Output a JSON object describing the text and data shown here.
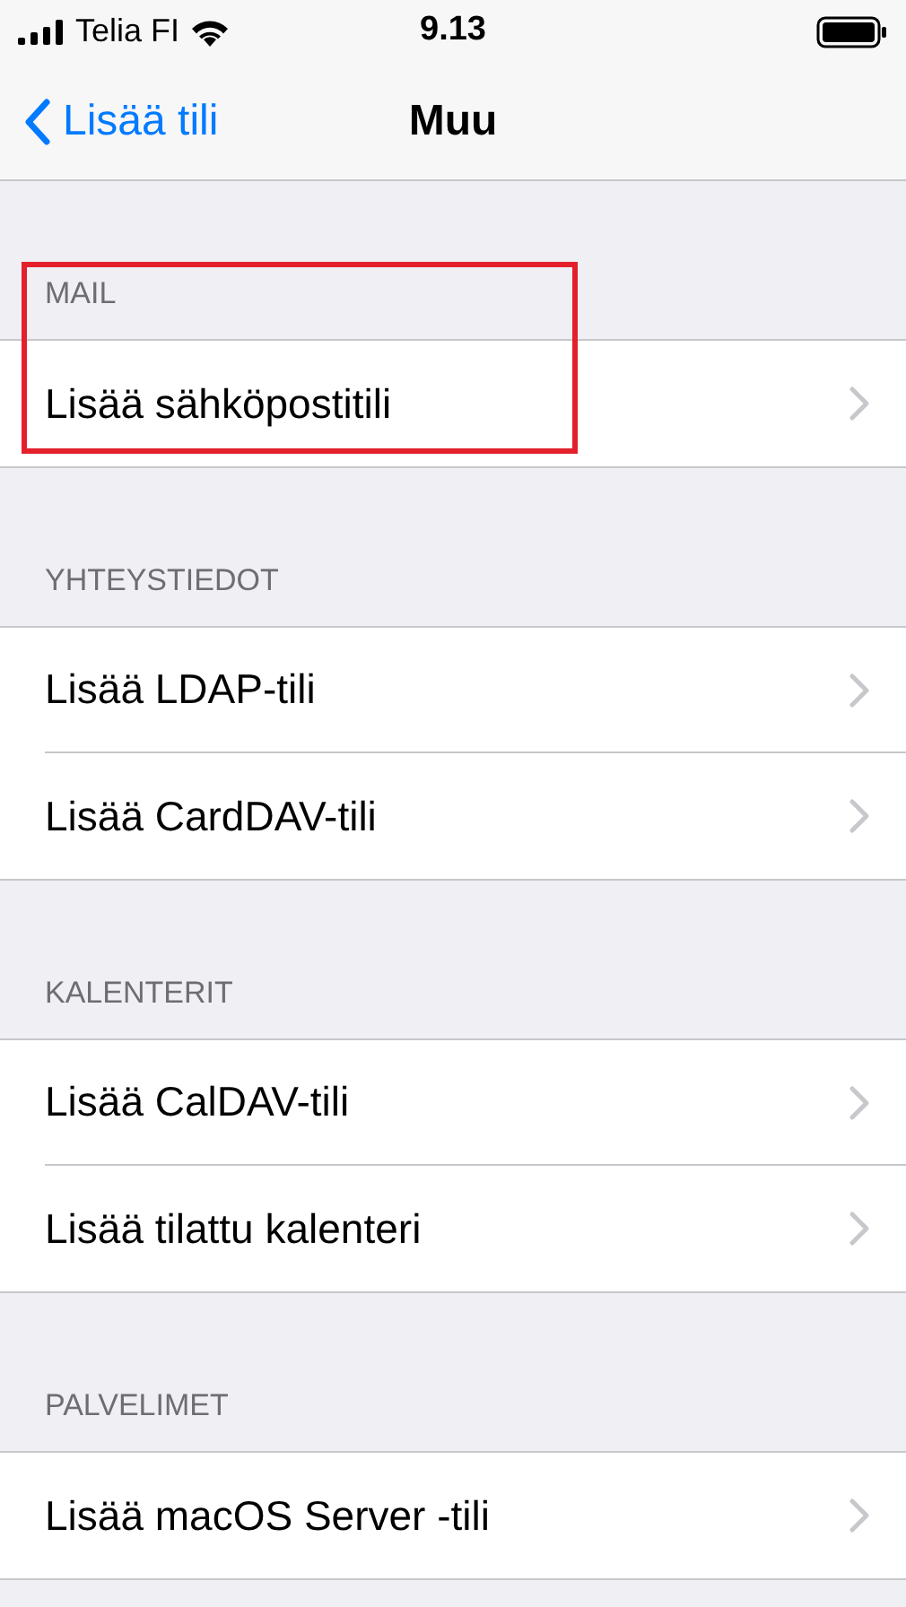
{
  "status_bar": {
    "carrier": "Telia FI",
    "time": "9.13"
  },
  "nav": {
    "back": "Lisää tili",
    "title": "Muu"
  },
  "sections": [
    {
      "header": "MAIL",
      "highlighted": true,
      "rows": [
        {
          "label": "Lisää sähköpostitili"
        }
      ]
    },
    {
      "header": "YHTEYSTIEDOT",
      "highlighted": false,
      "rows": [
        {
          "label": "Lisää LDAP-tili"
        },
        {
          "label": "Lisää CardDAV-tili"
        }
      ]
    },
    {
      "header": "KALENTERIT",
      "highlighted": false,
      "rows": [
        {
          "label": "Lisää CalDAV-tili"
        },
        {
          "label": "Lisää tilattu kalenteri"
        }
      ]
    },
    {
      "header": "PALVELIMET",
      "highlighted": false,
      "rows": [
        {
          "label": "Lisää macOS Server -tili"
        }
      ]
    }
  ]
}
